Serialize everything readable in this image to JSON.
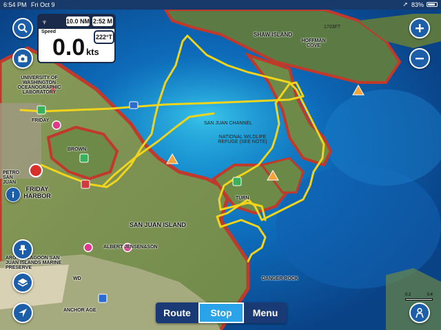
{
  "status_bar": {
    "time": "6:54 PM",
    "date": "Fri Oct 9",
    "battery": "83%"
  },
  "instrument": {
    "distance": "10.0 NM",
    "eta": "2:52 M",
    "speed_label": "Speed",
    "speed_value": "0.0",
    "speed_unit": "kts",
    "heading": "222°T"
  },
  "bottom_bar": {
    "route_label": "Route",
    "stop_label": "Stop",
    "menu_label": "Menu"
  },
  "map_labels": {
    "shaw_island": "SHAW ISLAND",
    "hoffman_cove": "HOFFMAN COVE",
    "depth_1703": "1703FT",
    "uw_lab": "UNIVERSITY OF WASHINGTON OCEANOGRAPHIC LABORATORY",
    "san_juan_channel": "SAN JUAN CHANNEL",
    "wildlife_refuge": "NATIONAL WILDLIFE REFUGE (SEE NOTE)",
    "brown": "BROWN",
    "petro": "PETRO SAN JUAN",
    "friday_harbor": "FRIDAY HARBOR",
    "friday": "FRIDAY",
    "san_juan_island": "SAN JUAN ISLAND",
    "turn": "TURN",
    "jensen": "ALBERT JENSEN&SON",
    "lagoon": "ARGYLE LAGOON SAN JUAN ISLANDS MARINE PRESERVE",
    "dinner_rock": "DANGER ROCK",
    "anchor": "ANCHOR AGE",
    "wd": "WD",
    "scale_left": "0.2",
    "scale_right": "0.4"
  },
  "colors": {
    "route": "#f2d41b",
    "ui_blue": "#1d5ea8",
    "active_blue": "#2aa3e8",
    "bar_navy": "#1a3a75"
  },
  "icons": {
    "search": "search-icon",
    "camera": "camera-icon",
    "zoom_in": "plus-icon",
    "zoom_out": "minus-icon",
    "waypoint": "pin-icon",
    "layers": "layers-icon",
    "locate": "navigation-arrow-icon",
    "person": "person-icon",
    "info": "info-icon"
  }
}
